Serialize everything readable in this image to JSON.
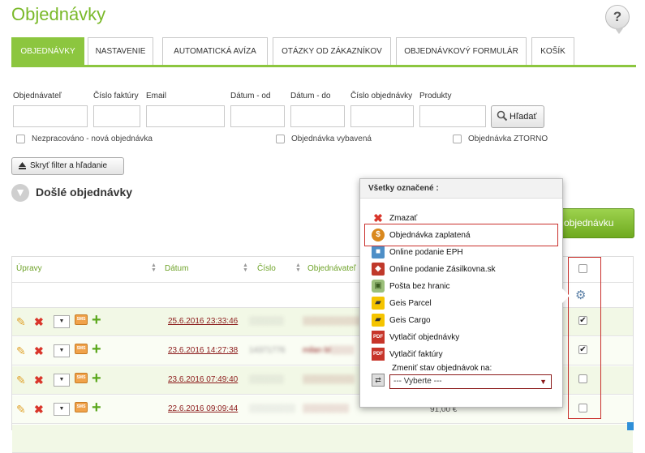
{
  "page": {
    "title": "Objednávky",
    "help_label": "?"
  },
  "tabs": [
    {
      "label": "OBJEDNÁVKY",
      "active": true
    },
    {
      "label": "NASTAVENIE",
      "active": false
    },
    {
      "label": "AUTOMATICKÁ AVÍZA",
      "active": false
    },
    {
      "label": "OTÁZKY OD ZÁKAZNÍKOV",
      "active": false
    },
    {
      "label": "OBJEDNÁVKOVÝ FORMULÁR",
      "active": false
    },
    {
      "label": "KOŠÍK",
      "active": false
    }
  ],
  "filters": {
    "fields": [
      {
        "label": "Objednávateľ",
        "value": ""
      },
      {
        "label": "Číslo faktúry",
        "value": ""
      },
      {
        "label": "Email",
        "value": ""
      },
      {
        "label": "Dátum - od",
        "value": ""
      },
      {
        "label": "Dátum - do",
        "value": ""
      },
      {
        "label": "Číslo objednávky",
        "value": ""
      },
      {
        "label": "Produkty",
        "value": ""
      }
    ],
    "search_label": "Hľadať",
    "checkboxes": [
      {
        "label": "Nezpracováno - nová objednávka",
        "checked": false
      },
      {
        "label": "Objednávka vybavená",
        "checked": false
      },
      {
        "label": "Objednávka ZTORNO",
        "checked": false
      }
    ],
    "hide_filter_label": "Skryť filter a hľadanie"
  },
  "orders": {
    "section_title": "Došlé objednávky",
    "new_order_label": "objednávku",
    "columns": {
      "edit": "Úpravy",
      "date": "Dátum",
      "number": "Číslo",
      "customer": "Objednávateľ"
    },
    "rows": [
      {
        "date": "25.6.2016 23:33:46",
        "number_obscured": "░░░░░░",
        "customer_obscured": "░░░░░░░░░░",
        "checked": true
      },
      {
        "date": "23.6.2016 14:27:38",
        "number_obscured": "14371776",
        "customer_obscured": "milan bl░░░░",
        "checked": true
      },
      {
        "date": "23.6.2016 07:49:40",
        "number_obscured": "░░░░░░",
        "customer_obscured": "░░░░░░░░░",
        "checked": false
      },
      {
        "date": "22.6.2016 09:09:44",
        "number_obscured": "░░░░░░░░",
        "customer_obscured": "░░░░░░░░",
        "checked": false
      }
    ],
    "partial_price": "91,00 €",
    "sms_label": "SMS"
  },
  "popup": {
    "header": "Všetky označené :",
    "items": [
      {
        "label": "Zmazať",
        "icon": "delete-icon"
      },
      {
        "label": "Objednávka zaplatená",
        "icon": "dollar-coin-icon"
      },
      {
        "label": "Online podanie EPH",
        "icon": "eph-icon"
      },
      {
        "label": "Online podanie Zásilkovna.sk",
        "icon": "zasilkovna-icon"
      },
      {
        "label": "Pošta bez hranic",
        "icon": "package-icon"
      },
      {
        "label": "Geis Parcel",
        "icon": "geis-icon"
      },
      {
        "label": "Geis Cargo",
        "icon": "geis-icon"
      },
      {
        "label": "Vytlačiť objednávky",
        "icon": "pdf-icon"
      },
      {
        "label": "Vytlačiť faktúry",
        "icon": "pdf-icon"
      }
    ],
    "change_status_label": "Zmeniť stav objednávok na:",
    "status_select_value": "--- Vyberte ---"
  },
  "colors": {
    "accent": "#8cc63f",
    "link": "#8b1a1a",
    "highlight": "#c9302c"
  }
}
